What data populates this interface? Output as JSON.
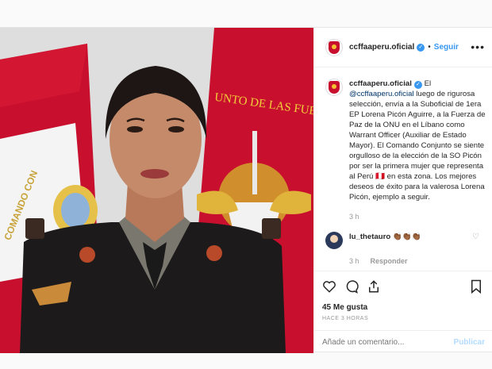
{
  "post": {
    "username": "ccffaaperu.oficial",
    "verified_mark": "✓",
    "separator": "•",
    "follow_label": "Seguir",
    "more_label": "•••"
  },
  "caption": {
    "username": "ccffaaperu.oficial",
    "mention": "@ccffaaperu.oficial",
    "text_1": " El ",
    "text_2": " luego de rigurosa selección, envía a la Suboficial de 1era EP Lorena Picón Aguirre, a la Fuerza de Paz de la ONU en el Líbano como Warrant Officer (Auxiliar de Estado Mayor). El Comando Conjunto se siente orgulloso de la elección de la SO Picón por ser la primera mujer que representa al Perú 🇵🇪 en esta zona. Los mejores deseos de éxito para la valerosa Lorena Picón, ejemplo a seguir.",
    "time": "3 h"
  },
  "comment": {
    "username": "lu_thetauro",
    "text": "👏🏾👏🏾👏🏾",
    "time": "3 h",
    "reply_label": "Responder",
    "heart_icon": "heart-icon"
  },
  "actions": {
    "likes": "45 Me gusta",
    "ago": "HACE 3 HORAS",
    "comment_placeholder": "Añade un comentario...",
    "publish_label": "Publicar"
  },
  "photo": {
    "banner_text": "UNTO DE LAS FUERZAS",
    "banner_text_left": "COMANDO CON"
  },
  "colors": {
    "accent": "#3897f0",
    "flag_red": "#c8102e",
    "uniform": "#1c1a1a"
  }
}
